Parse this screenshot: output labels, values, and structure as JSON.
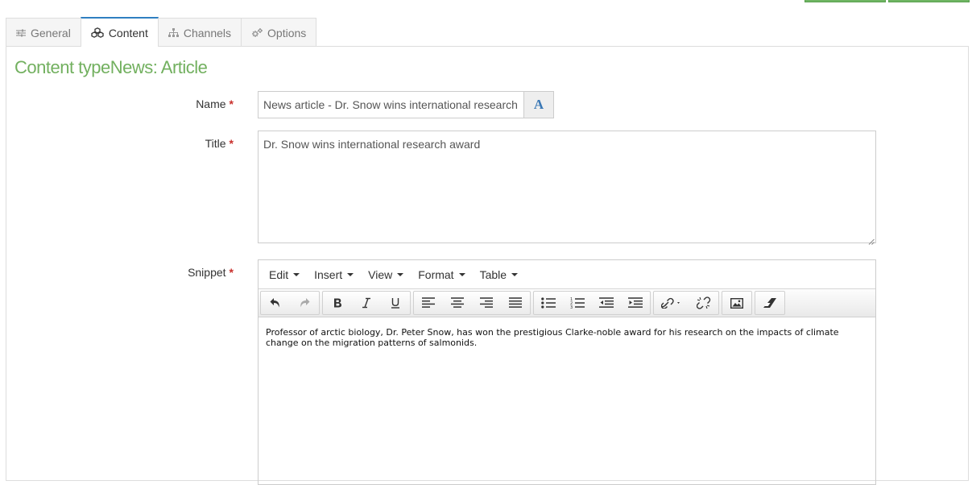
{
  "tabs": [
    {
      "label": "General",
      "icon": "sliders-icon"
    },
    {
      "label": "Content",
      "icon": "cubes-icon",
      "active": true
    },
    {
      "label": "Channels",
      "icon": "sitemap-icon"
    },
    {
      "label": "Options",
      "icon": "gears-icon"
    }
  ],
  "section_title": "Content typeNews: Article",
  "form": {
    "name_label": "Name",
    "name_value": "News article - Dr. Snow wins international research award",
    "name_addon": "A",
    "title_label": "Title",
    "title_value": "Dr. Snow wins international research award",
    "snippet_label": "Snippet",
    "required_mark": "*"
  },
  "editor": {
    "menus": [
      "Edit",
      "Insert",
      "View",
      "Format",
      "Table"
    ],
    "content": "Professor of arctic biology, Dr. Peter Snow, has won the prestigious Clarke-noble award for his research on the impacts of climate change on the migration patterns of salmonids."
  },
  "colors": {
    "accent_green": "#72b05f",
    "active_tab_border": "#2f7fc1",
    "required_red": "#c9302c",
    "addon_blue": "#3a78b5"
  }
}
